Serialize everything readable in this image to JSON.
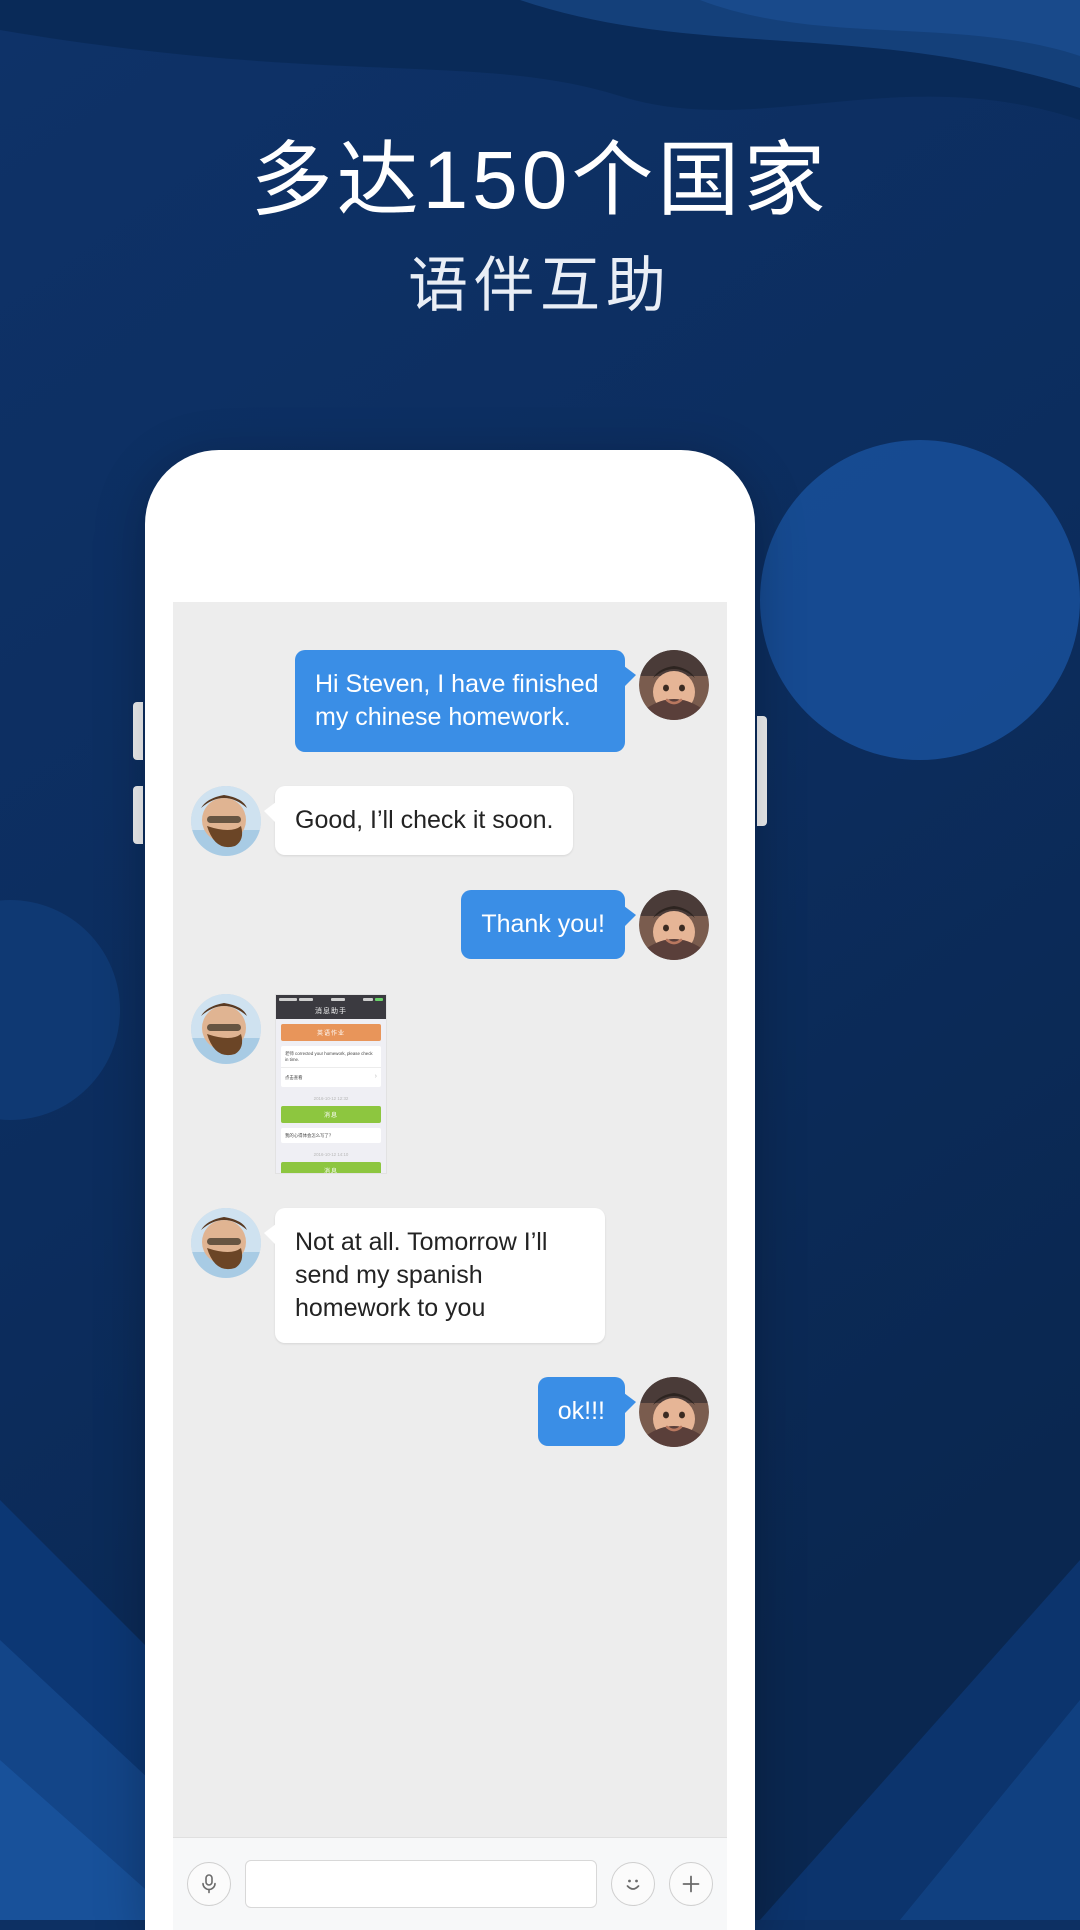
{
  "hero": {
    "headline": "多达150个国家",
    "subhead": "语伴互助"
  },
  "colors": {
    "background_dark": "#0d3063",
    "background_mid": "#123a73",
    "accent_blue": "#1f5ca8",
    "bubble_out": "#3a8ee6",
    "bubble_in": "#ffffff",
    "screen_bg": "#ededed",
    "banner_orange": "#e8955a",
    "button_green": "#8dc63f"
  },
  "phone": {
    "speaker_label": "earpiece-speaker",
    "camera_label": "front-camera"
  },
  "chat": {
    "messages": [
      {
        "side": "right",
        "type": "text",
        "text": "Hi Steven, I have finished my chinese homework."
      },
      {
        "side": "left",
        "type": "text",
        "text": "Good, I’ll check it soon."
      },
      {
        "side": "right",
        "type": "text",
        "text": "Thank you!"
      },
      {
        "side": "left",
        "type": "image",
        "text": ""
      },
      {
        "side": "left",
        "type": "text",
        "text": "Not at all. Tomorrow I’ll send my spanish homework to you"
      },
      {
        "side": "right",
        "type": "text",
        "text": "ok!!!"
      }
    ],
    "attachment": {
      "nav_title": "消息助手",
      "banner": "英语作业",
      "line_en": "老师 corrected your homework, please check in time.",
      "line_link": "点击查看",
      "hint_1": "2016-10-12 12:32",
      "button_1": "消息",
      "line_cn": "我的心得体会怎么写了？",
      "hint_2": "2016-10-12 14:10",
      "button_2": "消息"
    }
  },
  "toolbar": {
    "mic_label": "Voice",
    "input_placeholder": "",
    "input_value": "",
    "emoji_label": "Emoji",
    "plus_label": "More"
  }
}
